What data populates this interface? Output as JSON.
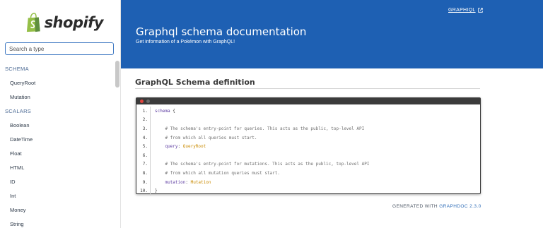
{
  "sidebar": {
    "logo_text": "shopify",
    "search_placeholder": "Search a type",
    "sections": [
      {
        "title": "SCHEMA",
        "items": [
          "QueryRoot",
          "Mutation"
        ]
      },
      {
        "title": "SCALARS",
        "items": [
          "Boolean",
          "DateTime",
          "Float",
          "HTML",
          "ID",
          "Int",
          "Money",
          "String"
        ]
      }
    ]
  },
  "header": {
    "graphiql_link": "GRAPHIQL",
    "title": "Graphql schema documentation",
    "subtitle": "Get information of a Pokémon with GraphQL!",
    "bg_color": "#1e60b3"
  },
  "main": {
    "section_title": "GraphQL Schema definition",
    "code_lines": [
      {
        "n": "1.",
        "indent": "",
        "tokens": [
          {
            "t": "schema",
            "k": "key"
          },
          {
            "t": " {",
            "k": "punct"
          }
        ]
      },
      {
        "n": "2.",
        "indent": "",
        "tokens": []
      },
      {
        "n": "3.",
        "indent": "    ",
        "tokens": [
          {
            "t": "# The schema's entry-point for queries. This acts as the public, top-level API",
            "k": "comment"
          }
        ]
      },
      {
        "n": "4.",
        "indent": "    ",
        "tokens": [
          {
            "t": "# from which all queries must start.",
            "k": "comment"
          }
        ]
      },
      {
        "n": "5.",
        "indent": "    ",
        "tokens": [
          {
            "t": "query",
            "k": "key"
          },
          {
            "t": ": ",
            "k": "punct"
          },
          {
            "t": "QueryRoot",
            "k": "type"
          }
        ]
      },
      {
        "n": "6.",
        "indent": "",
        "tokens": []
      },
      {
        "n": "7.",
        "indent": "    ",
        "tokens": [
          {
            "t": "# The schema's entry-point for mutations. This acts as the public, top-level API",
            "k": "comment"
          }
        ]
      },
      {
        "n": "8.",
        "indent": "    ",
        "tokens": [
          {
            "t": "# from which all mutation queries must start.",
            "k": "comment"
          }
        ]
      },
      {
        "n": "9.",
        "indent": "    ",
        "tokens": [
          {
            "t": "mutation",
            "k": "key"
          },
          {
            "t": ": ",
            "k": "punct"
          },
          {
            "t": "Mutation",
            "k": "type"
          }
        ]
      },
      {
        "n": "10.",
        "indent": "",
        "tokens": [
          {
            "t": "}",
            "k": "punct"
          }
        ]
      }
    ],
    "window_dot_colors": [
      "#e0443e",
      "#6b6b6b"
    ],
    "generated_prefix": "GENERATED WITH ",
    "generated_link": "GRAPHDOC 2.3.0"
  },
  "icons": {
    "logo": "shopify-bag-icon",
    "external": "external-link-icon"
  }
}
